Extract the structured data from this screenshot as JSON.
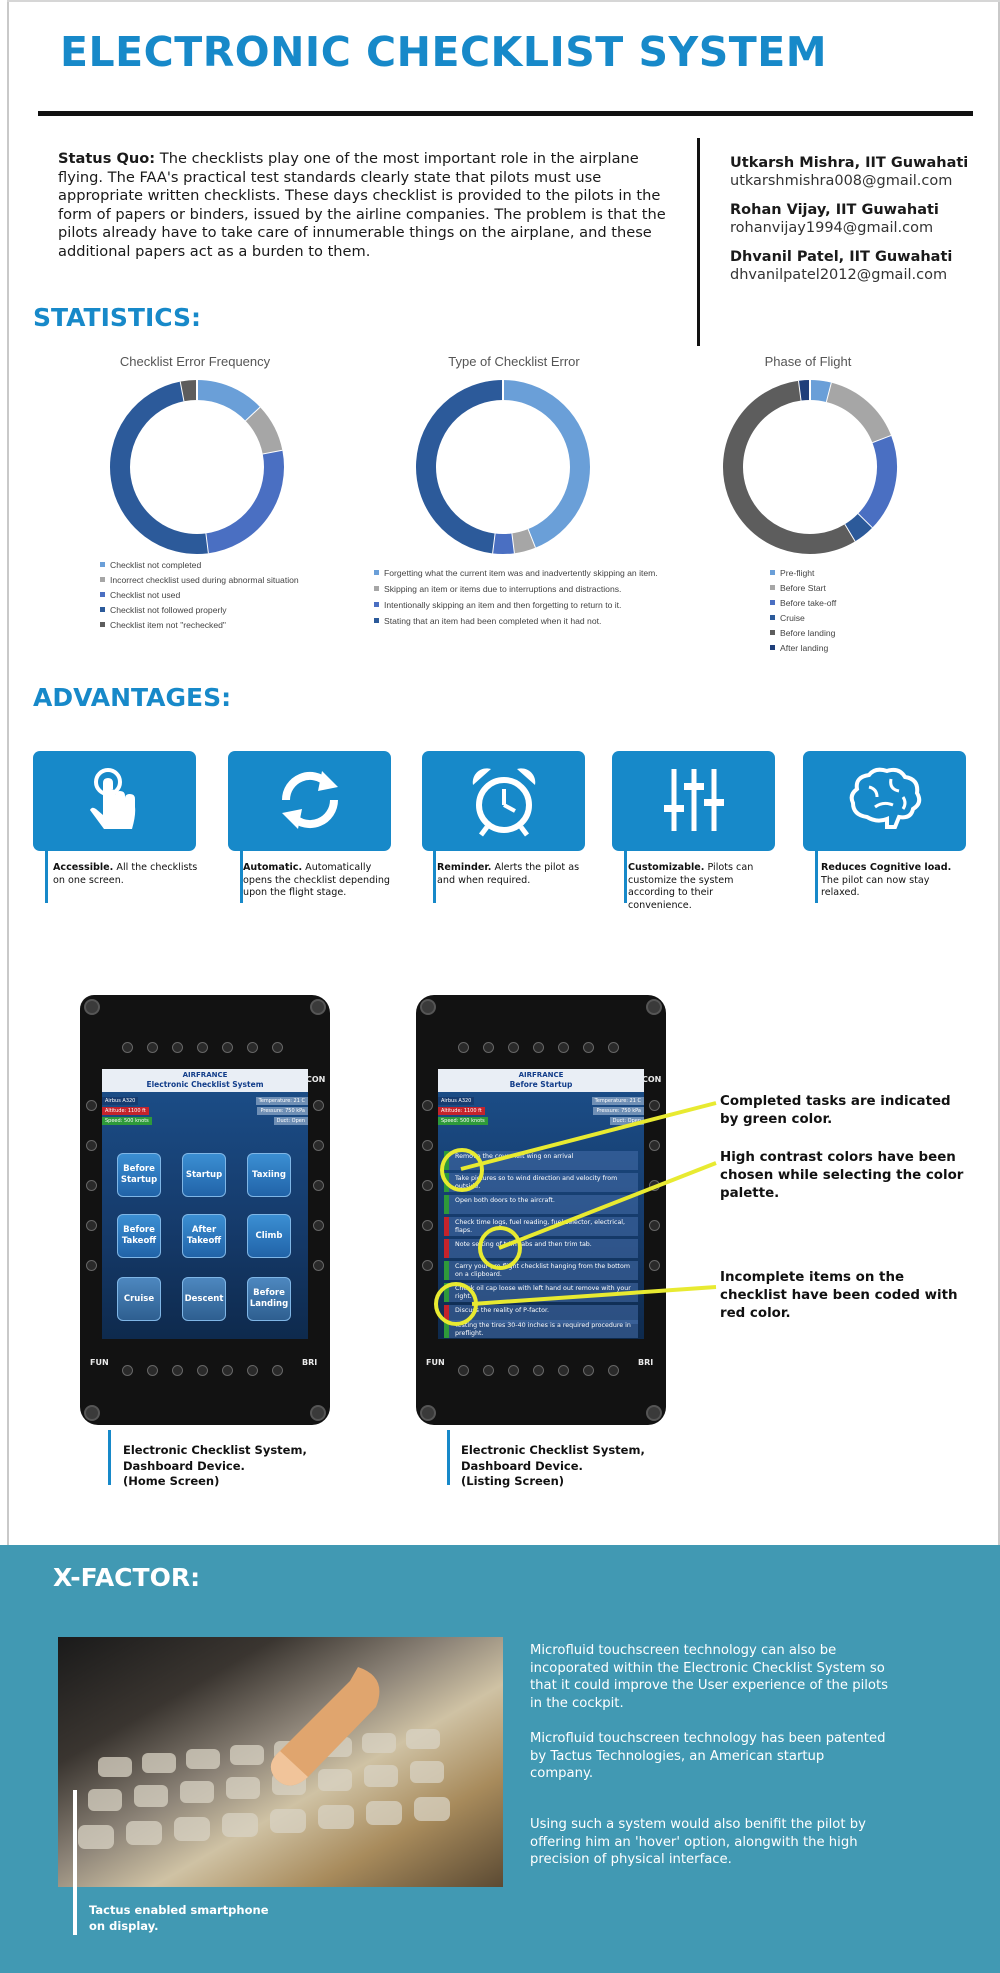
{
  "title": "ELECTRONIC CHECKLIST SYSTEM",
  "status_quo": {
    "label": "Status Quo:",
    "text": "The checklists play one of the most important role in the airplane flying. The FAA's practical test standards clearly state that pilots must use appropriate written checklists. These days checklist is provided to the pilots in the form of papers or binders, issued by the airline companies. The problem is that the pilots already have to take care of innumerable things on the airplane, and these additional papers act as a burden to them."
  },
  "authors": [
    {
      "name": "Utkarsh Mishra, IIT Guwahati",
      "email": "utkarshmishra008@gmail.com"
    },
    {
      "name": "Rohan Vijay, IIT Guwahati",
      "email": "rohanvijay1994@gmail.com"
    },
    {
      "name": "Dhvanil Patel, IIT Guwahati",
      "email": "dhvanilpatel2012@gmail.com"
    }
  ],
  "statistics_heading": "STATISTICS:",
  "chart_data": [
    {
      "type": "pie",
      "title": "Checklist Error Frequency",
      "donut": true,
      "legend_position": "bottom",
      "categories": [
        "Checklist not completed",
        "Incorrect checklist used during abnormal situation",
        "Checklist not used",
        "Checklist not followed properly",
        "Checklist item not \"rechecked\""
      ],
      "values": [
        13,
        9,
        26,
        49,
        3
      ],
      "colors": [
        "#6a9fd8",
        "#a6a6a6",
        "#4a6fc2",
        "#2c5a9a",
        "#5d5d5d"
      ]
    },
    {
      "type": "pie",
      "title": "Type of Checklist Error",
      "donut": true,
      "legend_position": "bottom",
      "categories": [
        "Forgetting what the current item was and inadvertently skipping an item.",
        "Skipping an item or items due to interruptions and distractions.",
        "Intentionally skipping an item and then forgetting to return to it.",
        "Stating that an item had been completed when it had not."
      ],
      "values": [
        44,
        4,
        4,
        48
      ],
      "colors": [
        "#6a9fd8",
        "#a6a6a6",
        "#4a6fc2",
        "#2c5a9a"
      ]
    },
    {
      "type": "pie",
      "title": "Phase of Flight",
      "donut": true,
      "legend_position": "bottom",
      "categories": [
        "Pre-flight",
        "Before Start",
        "Before take-off",
        "Cruise",
        "Before landing",
        "After landing"
      ],
      "values": [
        4,
        15,
        18,
        4,
        56,
        2
      ],
      "colors": [
        "#6a9fd8",
        "#a6a6a6",
        "#4a6fc2",
        "#2c5a9a",
        "#5d5d5d",
        "#1f3f7a"
      ]
    }
  ],
  "advantages_heading": "ADVANTAGES:",
  "advantages": [
    {
      "icon": "touch-hand-icon",
      "title": "Accessible.",
      "text": " All the checklists on one screen."
    },
    {
      "icon": "refresh-cycle-icon",
      "title": "Automatic.",
      "text": " Automatically opens the checklist depending upon the flight stage."
    },
    {
      "icon": "alarm-clock-icon",
      "title": "Reminder.",
      "text": " Alerts the pilot as and when required."
    },
    {
      "icon": "sliders-icon",
      "title": "Customizable.",
      "text": " Pilots can customize the system according to their convenience."
    },
    {
      "icon": "brain-icon",
      "title": "Reduces Cognitive load.",
      "text": " The pilot can now stay relaxed."
    }
  ],
  "device_common": {
    "brand": "AIRFRANCE",
    "left_label": "FUN",
    "right_label": "BRI",
    "top_label": "CON",
    "chips": {
      "airbus": "Airbus A320",
      "altitude": "Altitude: 1100 ft",
      "speed": "Speed: 500 knots",
      "temperature": "Temperature: 21 C",
      "pressure": "Pressure: 750 kPa",
      "duct": "Duct: Open"
    }
  },
  "home_screen": {
    "header": "Electronic Checklist System",
    "tiles": [
      "Before Startup",
      "Startup",
      "Taxiing",
      "Before Takeoff",
      "After Takeoff",
      "Climb",
      "Cruise",
      "Descent",
      "Before Landing"
    ],
    "caption_line1": "Electronic Checklist System,",
    "caption_line2": "Dashboard Device.",
    "caption_line3": "(Home Screen)"
  },
  "listing_screen": {
    "header": "Before Startup",
    "items": [
      {
        "text": "Remove the cover left wing on arrival",
        "status": "complete"
      },
      {
        "text": "Take pictures so to wind direction and velocity from outside.",
        "status": "complete"
      },
      {
        "text": "Open both doors to the aircraft.",
        "status": "complete"
      },
      {
        "text": "Check time logs, fuel reading, fuel selector, electrical, flaps.",
        "status": "incomplete"
      },
      {
        "text": "Note setting of trim tabs and then trim tab.",
        "status": "incomplete"
      },
      {
        "text": "Carry your pre-flight checklist hanging from the bottom on a clipboard.",
        "status": "complete"
      },
      {
        "text": "Check oil cap loose with left hand out remove with your right.",
        "status": "complete"
      },
      {
        "text": "Discuss the reality of P-factor.",
        "status": "incomplete"
      },
      {
        "text": "Testing the tires 30-40 inches is a required procedure in preflight.",
        "status": "complete"
      }
    ],
    "caption_line1": "Electronic Checklist System,",
    "caption_line2": "Dashboard Device.",
    "caption_line3": "(Listing Screen)"
  },
  "callouts": [
    "Completed tasks are indicated by green color.",
    "High contrast colors have been chosen while selecting the color palette.",
    "Incomplete items on the checklist have been coded with red color."
  ],
  "colors": {
    "accent": "#1789c9",
    "xfactor_bg": "#4199b3",
    "callout_yellow": "#e8ea31",
    "complete_green": "#2e9a3a",
    "incomplete_red": "#c5232b"
  },
  "xfactor": {
    "heading": "X-FACTOR:",
    "photo_caption_line1": "Tactus enabled smartphone",
    "photo_caption_line2": "on display.",
    "paragraphs": [
      "Microfluid touchscreen technology can also be incoporated within the Electronic Checklist System so that it could improve the User experience of the pilots in the cockpit.",
      "Microfluid touchscreen technology has been patented by Tactus Technologies, an American startup company.",
      "Using such a system would also benifit the pilot by offering him an 'hover' option, alongwith the high precision of physical interface."
    ]
  }
}
